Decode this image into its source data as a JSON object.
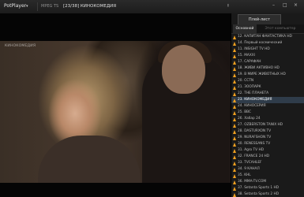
{
  "titlebar": {
    "app_name": "PotPlayer",
    "menu_arrow": "▾",
    "tab_label": "MPEG TS",
    "title": "[23/38] КИНОКОМЕДИЯ",
    "pin_icon": "pin-icon",
    "minimize_icon": "minimize-icon",
    "maximize_icon": "maximize-icon",
    "close_icon": "close-icon"
  },
  "video": {
    "watermark": "КИНОКОМЕДИЯ"
  },
  "playlist": {
    "title": "Плей-лист",
    "tabs": [
      {
        "label": "Основной",
        "active": true
      },
      {
        "label": "Этот компьютер",
        "active": false
      }
    ],
    "items": [
      {
        "label": "12. КАПИТАН ФАНТАСТИКА HD"
      },
      {
        "label": "14. Первый космический"
      },
      {
        "label": "11. INSIGHT TV HD"
      },
      {
        "label": "15. MAXXI"
      },
      {
        "label": "17. САРАФАН"
      },
      {
        "label": "18. ЖИВИ АКТИВНО HD"
      },
      {
        "label": "19. В МИРЕ ЖИВОТНЫХ HD"
      },
      {
        "label": "20. CCTN"
      },
      {
        "label": "21. ЗООПАРК"
      },
      {
        "label": "22. THE ПЛАНЕТА"
      },
      {
        "label": "23. КИНОКОМЕДИЯ",
        "active": true
      },
      {
        "label": "24. КИНОСЕРИЯ"
      },
      {
        "label": "25. BBC"
      },
      {
        "label": "26. Хабар 24"
      },
      {
        "label": "27. OZBERSTON TANIX HD"
      },
      {
        "label": "28. DASTURXON TV"
      },
      {
        "label": "29. NURAFSHON TV"
      },
      {
        "label": "30. RENESSANS TV"
      },
      {
        "label": "31. Agro TV HD"
      },
      {
        "label": "32. FRANCE 24 HD"
      },
      {
        "label": "33. TVCAHLEF"
      },
      {
        "label": "34. 9 КАНАЛ"
      },
      {
        "label": "35. KHL"
      },
      {
        "label": "36. MMA-TV.COM"
      },
      {
        "label": "37. Setanta Sports 1 HD"
      },
      {
        "label": "38. Setanta Sports 2 HD"
      }
    ]
  }
}
